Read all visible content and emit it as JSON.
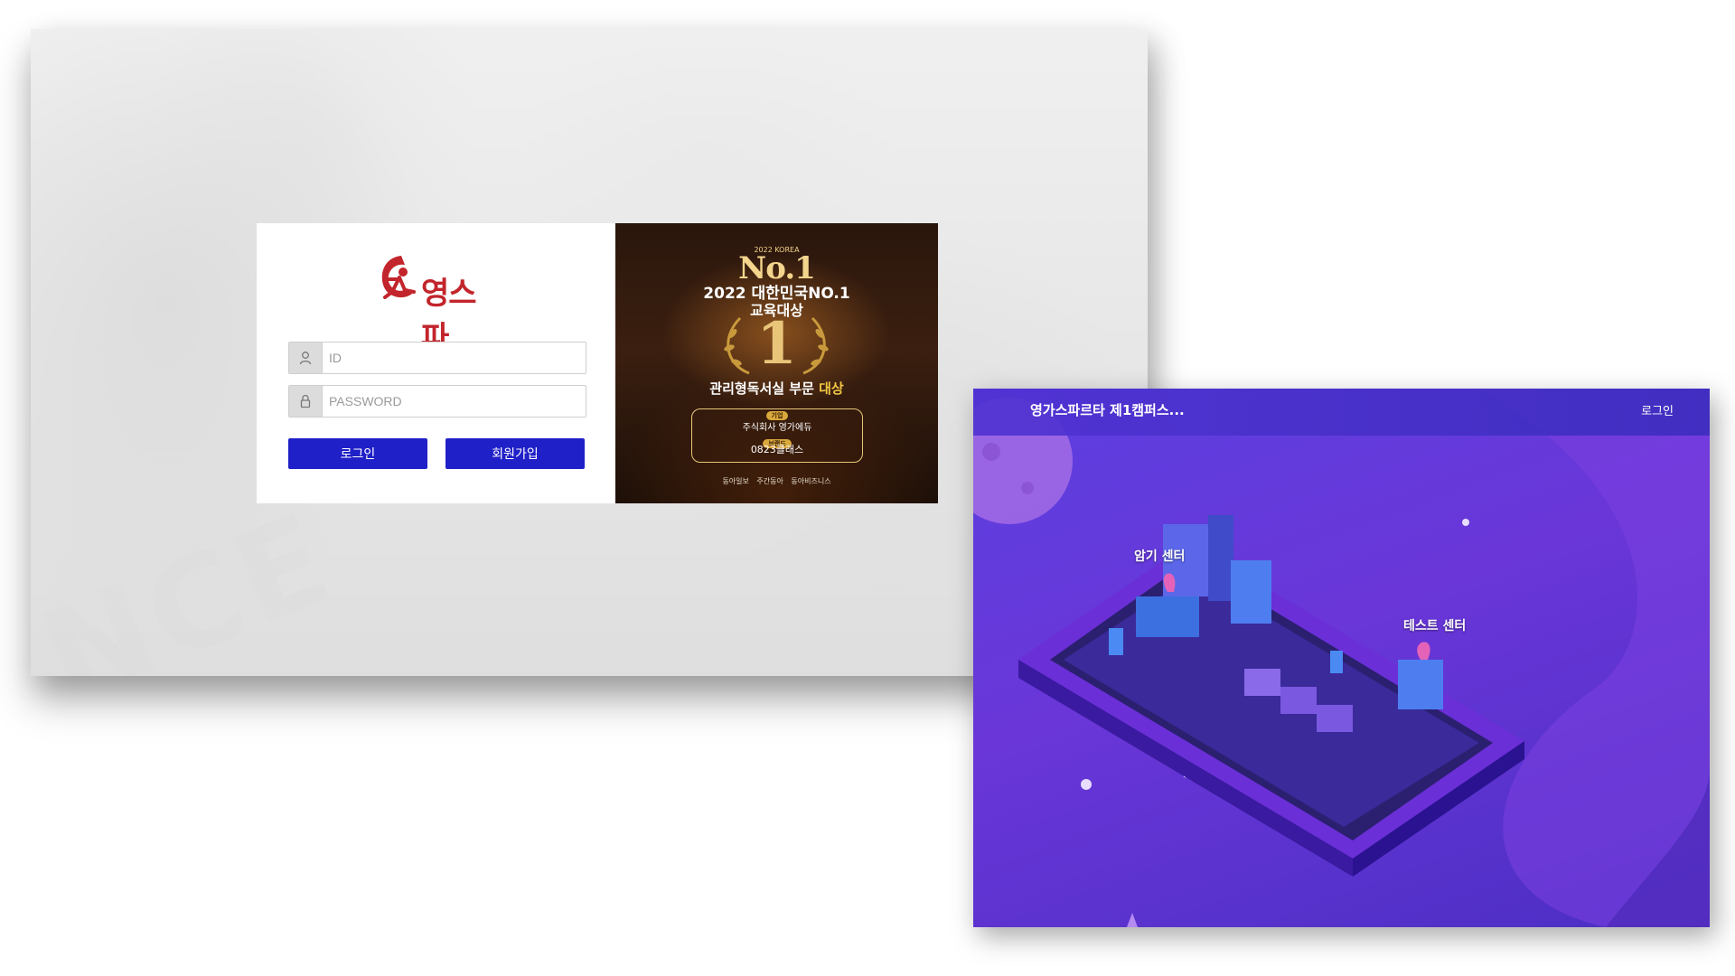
{
  "login_page": {
    "logo": {
      "text": "영스파"
    },
    "id_field": {
      "placeholder": "ID",
      "value": ""
    },
    "password_field": {
      "placeholder": "PASSWORD",
      "value": ""
    },
    "login_button": "로그인",
    "signup_button": "회원가입",
    "award": {
      "small_label": "2022 KOREA",
      "no1": "No.1",
      "title_line1": "2022 대한민국NO.1",
      "title_line2": "교육대상",
      "big_number": "1",
      "category_text": "관리형독서실 부문",
      "category_highlight": "대상",
      "pill_company": "기업",
      "company": "주식회사 영가에듀",
      "pill_brand": "브랜드",
      "brand": "0823클래스",
      "sponsors": "동아일보 주간동아 동아비즈니스"
    }
  },
  "campus_page": {
    "title": "영가스파르타 제1캠퍼스...",
    "login_link": "로그인",
    "markers": [
      {
        "label": "암기 센터"
      },
      {
        "label": "테스트 센터"
      }
    ],
    "colors": {
      "accent": "#2020c8",
      "background": "#5b3fe0"
    }
  }
}
